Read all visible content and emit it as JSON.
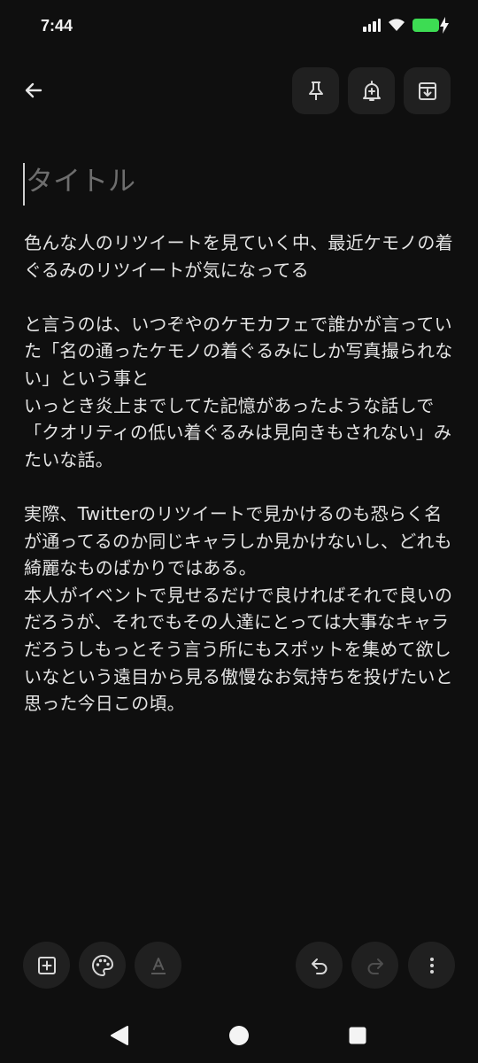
{
  "status_bar": {
    "time": "7:44",
    "icons": [
      "signal-icon",
      "wifi-icon",
      "battery-charging-icon"
    ],
    "battery_color": "#3ddc53"
  },
  "top_bar": {
    "back_icon": "arrow-left-icon",
    "actions": [
      {
        "name": "pin-button",
        "icon": "pin-icon"
      },
      {
        "name": "reminder-button",
        "icon": "bell-plus-icon"
      },
      {
        "name": "archive-button",
        "icon": "archive-icon"
      }
    ]
  },
  "note": {
    "title_placeholder": "タイトル",
    "title_value": "",
    "body": "色んな人のリツイートを見ていく中、最近ケモノの着ぐるみのリツイートが気になってる\n\nと言うのは、いつぞやのケモカフェで誰かが言っていた「名の通ったケモノの着ぐるみにしか写真撮られない」という事と\nいっとき炎上までしてた記憶があったような話しで「クオリティの低い着ぐるみは見向きもされない」みたいな話。\n\n実際、Twitterのリツイートで見かけるのも恐らく名が通ってるのか同じキャラしか見かけないし、どれも綺麗なものばかりではある。\n本人がイベントで見せるだけで良ければそれで良いのだろうが、それでもその人達にとっては大事なキャラだろうしもっとそう言う所にもスポットを集めて欲しいなという遠目から見る傲慢なお気持ちを投げたいと思った今日この頃。"
  },
  "bottom_toolbar": {
    "left": [
      {
        "name": "add-button",
        "icon": "plus-box-icon"
      },
      {
        "name": "color-button",
        "icon": "palette-icon"
      },
      {
        "name": "text-format-button",
        "icon": "text-format-icon",
        "disabled": true
      }
    ],
    "right": [
      {
        "name": "undo-button",
        "icon": "undo-icon"
      },
      {
        "name": "redo-button",
        "icon": "redo-icon",
        "disabled": true
      },
      {
        "name": "more-button",
        "icon": "more-vertical-icon"
      }
    ]
  },
  "nav_bar": {
    "items": [
      "back-triangle-icon",
      "home-circle-icon",
      "recents-square-icon"
    ]
  }
}
